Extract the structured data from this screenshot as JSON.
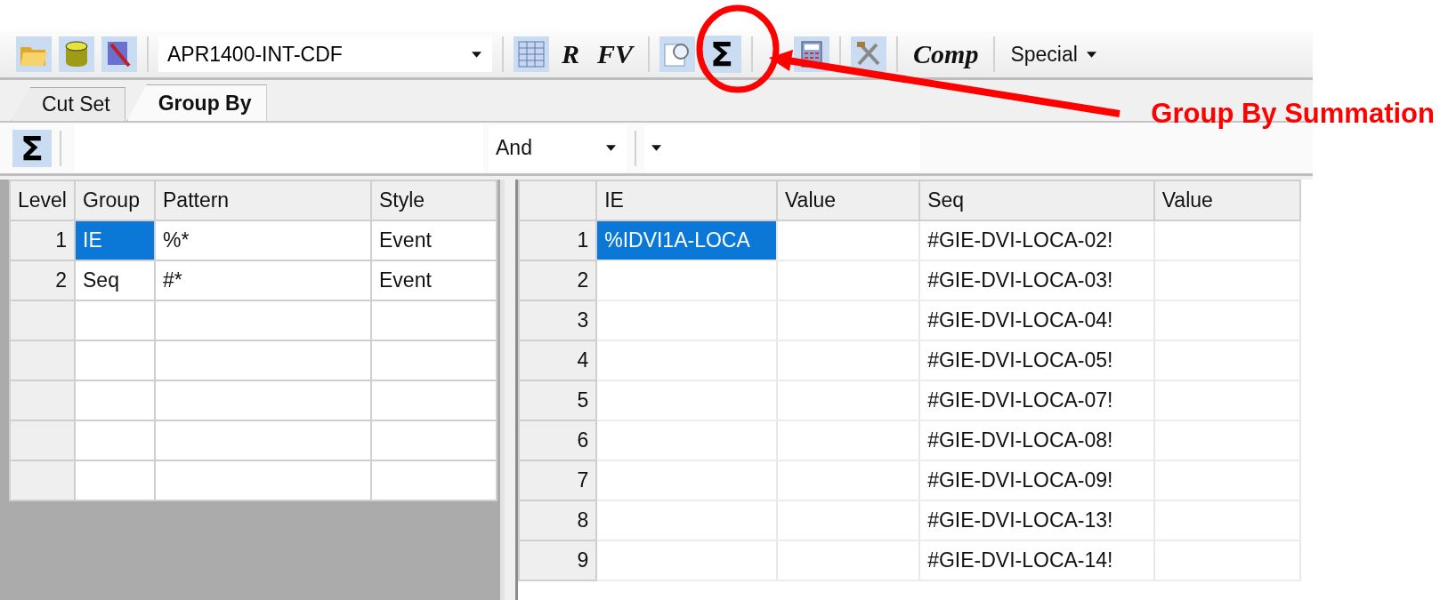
{
  "toolbar": {
    "model_select": "APR1400-INT-CDF",
    "r_button": "R",
    "fv_button": "FV",
    "sum_button": "Σ",
    "comp_button": "Comp",
    "special_menu": "Special"
  },
  "tabs": [
    {
      "label": "Cut Set",
      "selected": false
    },
    {
      "label": "Group By",
      "selected": true
    }
  ],
  "filter_bar": {
    "sum_button": "Σ",
    "operator": "And"
  },
  "group_table": {
    "columns": [
      "Level",
      "Group",
      "Pattern",
      "Style"
    ],
    "rows": [
      {
        "level": "1",
        "group": "IE",
        "pattern": "%*",
        "style": "Event",
        "selected": true
      },
      {
        "level": "2",
        "group": "Seq",
        "pattern": "#*",
        "style": "Event",
        "selected": false
      }
    ]
  },
  "result_table": {
    "columns": [
      "IE",
      "Value",
      "Seq",
      "Value"
    ],
    "rows": [
      {
        "number": "1",
        "ie": "%IDVI1A-LOCA",
        "seq": "#GIE-DVI-LOCA-02!",
        "selected": true
      },
      {
        "number": "2",
        "seq": "#GIE-DVI-LOCA-03!",
        "selected": false
      },
      {
        "number": "3",
        "seq": "#GIE-DVI-LOCA-04!",
        "selected": false
      },
      {
        "number": "4",
        "seq": "#GIE-DVI-LOCA-05!",
        "selected": false
      },
      {
        "number": "5",
        "seq": "#GIE-DVI-LOCA-07!",
        "selected": false
      },
      {
        "number": "6",
        "seq": "#GIE-DVI-LOCA-08!",
        "selected": false
      },
      {
        "number": "7",
        "seq": "#GIE-DVI-LOCA-09!",
        "selected": false
      },
      {
        "number": "8",
        "seq": "#GIE-DVI-LOCA-13!",
        "selected": false
      },
      {
        "number": "9",
        "seq": "#GIE-DVI-LOCA-14!",
        "selected": false
      }
    ]
  },
  "annotation": {
    "label": "Group By Summation"
  }
}
